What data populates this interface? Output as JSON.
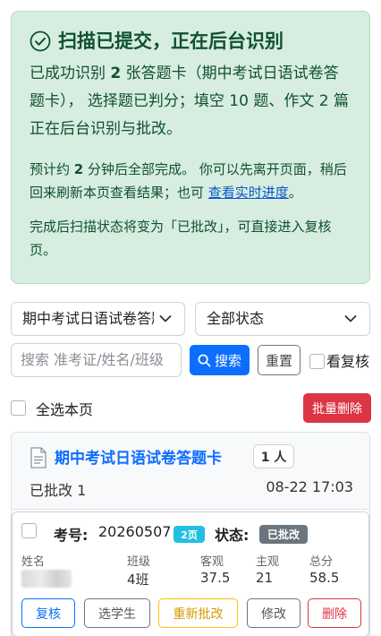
{
  "alert": {
    "title": "扫描已提交，正在后台识别",
    "main_prefix": "已成功识别 ",
    "main_count": "2",
    "main_rest": " 张答题卡（期中考试日语试卷答题卡）， 选择题已判分；填空 10 题、作文 2 篇正在后台识别与批改。",
    "sub_prefix": "预计约 ",
    "sub_minutes": "2",
    "sub_rest": " 分钟后全部完成。 你可以先离开页面，稍后回来刷新本页查看结果；也可 ",
    "sub_link": "查看实时进度",
    "sub_end": "。",
    "note": "完成后扫描状态将变为「已批改」，可直接进入复核页。",
    "bg_color": "#d7ede0",
    "text_color": "#0f5132"
  },
  "filters": {
    "exam_select": "期中考试日语试卷答题卡",
    "status_select": "全部状态",
    "search_placeholder": "搜索 准考证/姓名/班级",
    "search_button": "搜索",
    "reset_button": "重置",
    "review_checkbox_label": "看复核"
  },
  "bulk": {
    "select_all_label": "全选本页",
    "delete_button": "批量删除"
  },
  "group": {
    "title": "期中考试日语试卷答题卡",
    "count_badge": "1 人",
    "status": "已批改 1",
    "time": "08-22 17:03"
  },
  "item": {
    "exam_label": "考号:",
    "exam_number": "20260507",
    "pages_badge": "2页",
    "status_label": "状态:",
    "status_badge": "已批改",
    "headers": {
      "name": "姓名",
      "class": "班级",
      "objective": "客观",
      "subjective": "主观",
      "total": "总分"
    },
    "values": {
      "class": "4班",
      "objective": "37.5",
      "subjective": "21",
      "total": "58.5"
    },
    "actions": {
      "review": "复核",
      "select_student": "选学生",
      "regrade": "重新批改",
      "edit": "修改",
      "delete": "删除"
    }
  }
}
